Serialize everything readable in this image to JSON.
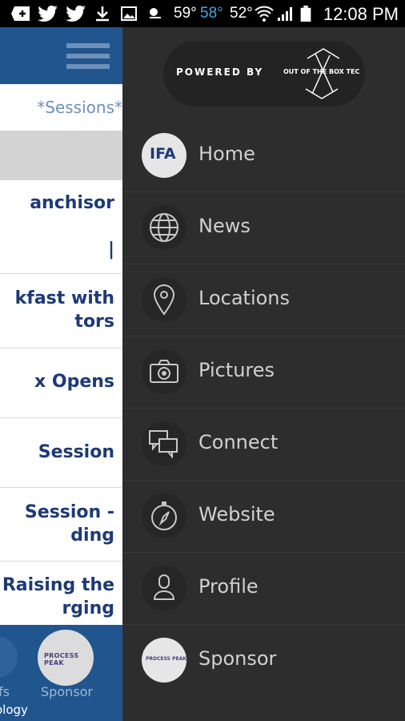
{
  "status_bar": {
    "temp_1": "59°",
    "temp_2": "58°",
    "temp_3": "52°",
    "time": "12:08 PM",
    "temp_2_color": "#4aa3df"
  },
  "app": {
    "sessions_tab": "*Sessions*",
    "list_rows": [
      "anchisor\n\n|",
      "kfast with\ntors",
      "x Opens",
      " Session",
      " Session -\nding",
      "- Raising the\nrging"
    ],
    "bottom_bar": {
      "left_label": "fs",
      "sponsor_label": "Sponsor",
      "sponsor_logo_text": "PROCESS PEAK",
      "credit": "ology"
    },
    "header_color": "#21558e"
  },
  "drawer": {
    "powered_by": "POWERED BY",
    "brand_logo_text": "OUT OF THE BOX TECHNOLOGY",
    "menu": [
      {
        "label": "Home",
        "icon": "ifa-logo-icon",
        "logo_text": "IFA"
      },
      {
        "label": "News",
        "icon": "globe-icon"
      },
      {
        "label": "Locations",
        "icon": "map-pin-icon"
      },
      {
        "label": "Pictures",
        "icon": "camera-icon"
      },
      {
        "label": "Connect",
        "icon": "chat-bubbles-icon"
      },
      {
        "label": "Website",
        "icon": "compass-icon"
      },
      {
        "label": "Profile",
        "icon": "user-icon"
      },
      {
        "label": "Sponsor",
        "icon": "sponsor-logo-icon",
        "logo_text": "PROCESS PEAK"
      }
    ],
    "background_color": "#2d2d2d"
  }
}
